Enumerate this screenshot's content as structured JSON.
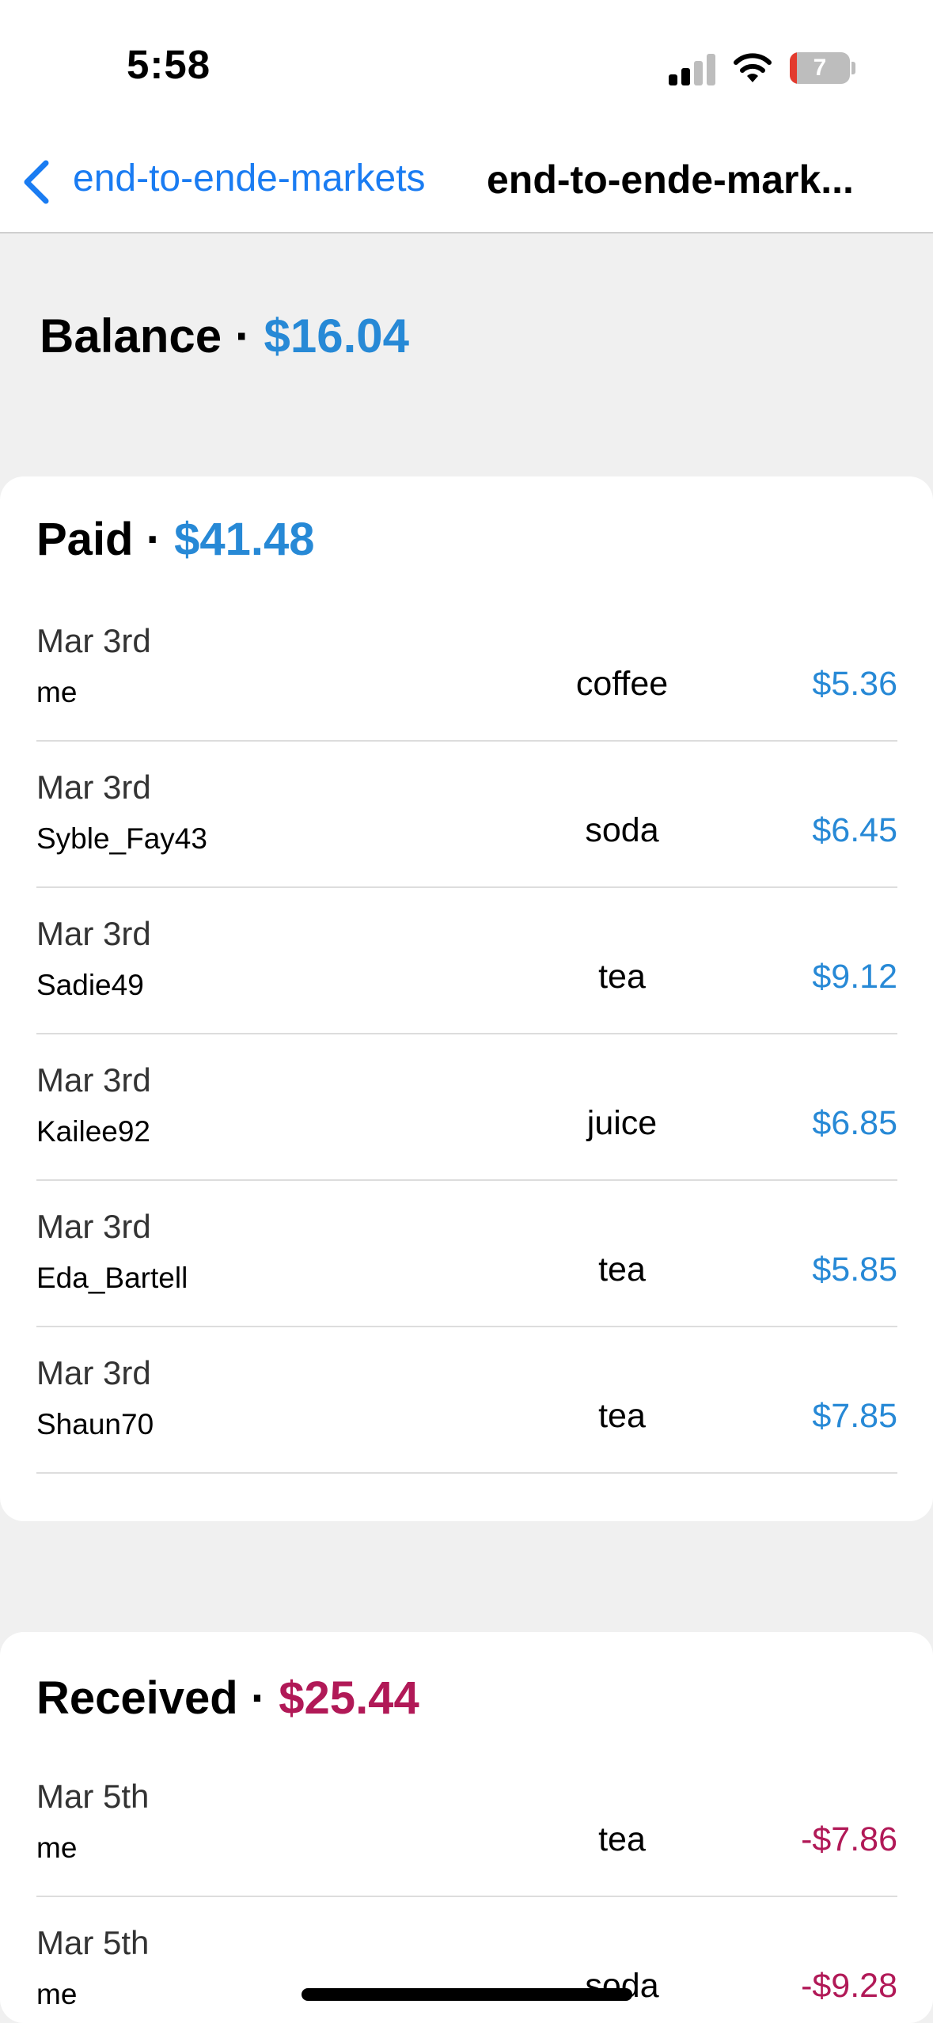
{
  "status": {
    "time": "5:58",
    "battery": "7"
  },
  "nav": {
    "back_label": "end-to-ende-markets",
    "title": "end-to-ende-mark..."
  },
  "balance": {
    "label": "Balance",
    "separator": "·",
    "amount": "$16.04"
  },
  "paid": {
    "label": "Paid",
    "separator": "·",
    "total": "$41.48",
    "rows": [
      {
        "date": "Mar 3rd",
        "user": "me",
        "item": "coffee",
        "amount": "$5.36"
      },
      {
        "date": "Mar 3rd",
        "user": "Syble_Fay43",
        "item": "soda",
        "amount": "$6.45"
      },
      {
        "date": "Mar 3rd",
        "user": "Sadie49",
        "item": "tea",
        "amount": "$9.12"
      },
      {
        "date": "Mar 3rd",
        "user": "Kailee92",
        "item": "juice",
        "amount": "$6.85"
      },
      {
        "date": "Mar 3rd",
        "user": "Eda_Bartell",
        "item": "tea",
        "amount": "$5.85"
      },
      {
        "date": "Mar 3rd",
        "user": "Shaun70",
        "item": "tea",
        "amount": "$7.85"
      }
    ]
  },
  "received": {
    "label": "Received",
    "separator": "·",
    "total": "$25.44",
    "rows": [
      {
        "date": "Mar 5th",
        "user": "me",
        "item": "tea",
        "amount": "-$7.86"
      },
      {
        "date": "Mar 5th",
        "user": "me",
        "item": "soda",
        "amount": "-$9.28"
      }
    ]
  },
  "colors": {
    "paid": "#2789d6",
    "received": "#b11957",
    "link": "#1a7cf2"
  },
  "icons": {
    "back": "chevron-left-icon",
    "signal": "cellular-signal-icon",
    "wifi": "wifi-icon",
    "battery": "battery-icon"
  }
}
